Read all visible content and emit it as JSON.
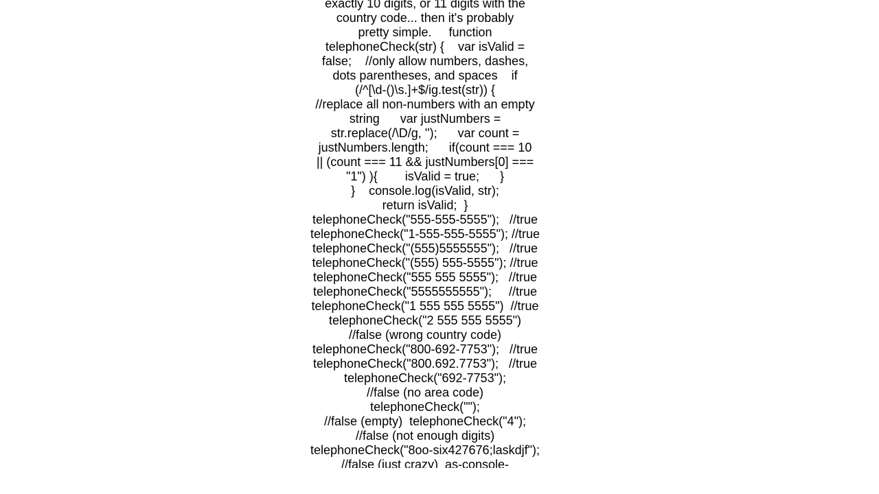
{
  "document": {
    "lines": [
      "exactly 10 digits, or 11 digits with the",
      "country code... then it's probably",
      "pretty simple.     function",
      "telephoneCheck(str) {    var isValid =",
      "false;    //only allow numbers, dashes,",
      "dots parentheses, and spaces    if",
      "(/^[\\d-()\\s.]+$/ig.test(str)) {",
      "//replace all non-numbers with an empty",
      "string      var justNumbers =",
      "str.replace(/\\D/g, '');      var count =",
      "justNumbers.length;      if(count === 10",
      "|| (count === 11 && justNumbers[0] ===",
      "\"1\") ){        isValid = true;      }",
      "}    console.log(isValid, str);",
      "return isValid;  }",
      "telephoneCheck(\"555-555-5555\");   //true",
      "telephoneCheck(\"1-555-555-5555\"); //true",
      "telephoneCheck(\"(555)5555555\");   //true",
      "telephoneCheck(\"(555) 555-5555\"); //true",
      "telephoneCheck(\"555 555 5555\");   //true",
      "telephoneCheck(\"5555555555\");     //true",
      "telephoneCheck(\"1 555 555 5555\")  //true",
      "telephoneCheck(\"2 555 555 5555\")",
      "//false (wrong country code)",
      "telephoneCheck(\"800-692-7753\");   //true",
      "telephoneCheck(\"800.692.7753\");   //true",
      "telephoneCheck(\"692-7753\");",
      "//false (no area code)",
      "telephoneCheck(\"\");",
      "//false (empty)  telephoneCheck(\"4\");",
      "//false (not enough digits)",
      "telephoneCheck(\"8oo-six427676;laskdjf\");",
      "//false (just crazy)  as-console-"
    ]
  }
}
